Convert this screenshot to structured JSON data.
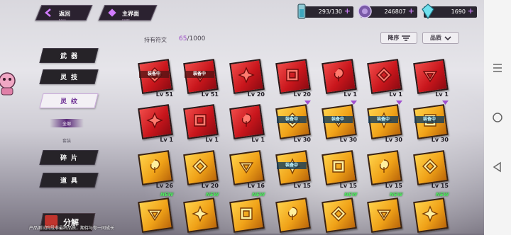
{
  "top_bar": {
    "back": {
      "label": "返回",
      "sub": "BACK"
    },
    "home": {
      "label": "主界面",
      "sub": "HOME"
    },
    "stamina": {
      "value": "293/130",
      "icon": "battery-icon"
    },
    "gold": {
      "value": "246807",
      "icon": "coin-icon"
    },
    "gems": {
      "value": "1690",
      "icon": "crystal-icon"
    }
  },
  "sidebar": {
    "tabs": [
      {
        "label": "武器",
        "active": false
      },
      {
        "label": "灵技",
        "active": false
      },
      {
        "label": "灵纹",
        "active": true
      },
      {
        "label": "碎片",
        "active": false
      },
      {
        "label": "道具",
        "active": false
      }
    ],
    "subtabs": [
      {
        "label": "全部",
        "active": true
      },
      {
        "label": "套装",
        "active": false
      }
    ]
  },
  "header": {
    "owned_label": "持有符文",
    "owned_current": "65",
    "owned_max": "/1000",
    "sort_label": "降序",
    "filter_label": "品质"
  },
  "runes": [
    {
      "level": "Lv 51",
      "color": "red",
      "equipped": true,
      "arrow": false,
      "new": false
    },
    {
      "level": "Lv 51",
      "color": "red",
      "equipped": true,
      "arrow": false,
      "new": false
    },
    {
      "level": "Lv 20",
      "color": "red",
      "equipped": false,
      "arrow": false,
      "new": false
    },
    {
      "level": "Lv 20",
      "color": "red",
      "equipped": false,
      "arrow": false,
      "new": false
    },
    {
      "level": "Lv 1",
      "color": "red",
      "equipped": false,
      "arrow": false,
      "new": false
    },
    {
      "level": "Lv 1",
      "color": "red",
      "equipped": false,
      "arrow": false,
      "new": false
    },
    {
      "level": "Lv 1",
      "color": "red",
      "equipped": false,
      "arrow": false,
      "new": false
    },
    {
      "level": "Lv 1",
      "color": "red",
      "equipped": false,
      "arrow": false,
      "new": false
    },
    {
      "level": "Lv 1",
      "color": "red",
      "equipped": false,
      "arrow": false,
      "new": false
    },
    {
      "level": "Lv 1",
      "color": "red",
      "equipped": false,
      "arrow": false,
      "new": false
    },
    {
      "level": "Lv 30",
      "color": "gold",
      "equipped": true,
      "arrow": true,
      "new": false
    },
    {
      "level": "Lv 30",
      "color": "gold",
      "equipped": true,
      "arrow": true,
      "new": false
    },
    {
      "level": "Lv 30",
      "color": "gold",
      "equipped": true,
      "arrow": true,
      "new": false
    },
    {
      "level": "Lv 30",
      "color": "gold",
      "equipped": true,
      "arrow": true,
      "new": false
    },
    {
      "level": "Lv 26",
      "color": "gold",
      "equipped": false,
      "arrow": false,
      "new": false
    },
    {
      "level": "Lv 20",
      "color": "gold",
      "equipped": false,
      "arrow": false,
      "new": false
    },
    {
      "level": "Lv 16",
      "color": "gold",
      "equipped": false,
      "arrow": false,
      "new": false
    },
    {
      "level": "Lv 15",
      "color": "gold",
      "equipped": true,
      "arrow": false,
      "new": false
    },
    {
      "level": "Lv 15",
      "color": "gold",
      "equipped": false,
      "arrow": false,
      "new": false
    },
    {
      "level": "Lv 15",
      "color": "gold",
      "equipped": false,
      "arrow": false,
      "new": false
    },
    {
      "level": "Lv 15",
      "color": "gold",
      "equipped": false,
      "arrow": false,
      "new": false
    },
    {
      "level": "",
      "color": "gold",
      "equipped": false,
      "arrow": false,
      "new": true
    },
    {
      "level": "",
      "color": "gold",
      "equipped": false,
      "arrow": false,
      "new": true
    },
    {
      "level": "",
      "color": "gold",
      "equipped": false,
      "arrow": false,
      "new": true
    },
    {
      "level": "",
      "color": "gold",
      "equipped": false,
      "arrow": false,
      "new": false
    },
    {
      "level": "",
      "color": "gold",
      "equipped": false,
      "arrow": false,
      "new": true
    },
    {
      "level": "",
      "color": "gold",
      "equipped": false,
      "arrow": false,
      "new": true
    },
    {
      "level": "",
      "color": "gold",
      "equipped": false,
      "arrow": false,
      "new": true
    }
  ],
  "labels": {
    "equipped": "装备中",
    "new": "NEW"
  },
  "bottom": {
    "decompose_label": "分解",
    "footer_note": "产品测试阶段非最终品质，期待与你一同成长"
  },
  "colors": {
    "accent": "#9a49c3",
    "panel_dark": "#262328",
    "rune_red": "#d42026",
    "rune_gold": "#f2a31b"
  }
}
